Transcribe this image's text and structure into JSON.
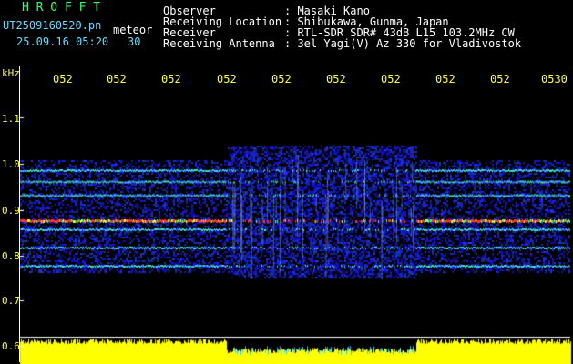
{
  "header": {
    "brand": "H R O F F T",
    "filename": "UT2509160520.pn",
    "mode": "meteor",
    "date_time": "25.09.16 05:20",
    "duration": "30",
    "info_labels": [
      "Observer",
      "Receiving Location",
      "Receiver",
      "Receiving Antenna"
    ],
    "info_values": [
      ": Masaki Kano",
      ": Shibukawa, Gunma, Japan",
      ": RTL-SDR SDR# 43dB L15 103.2MHz CW",
      ": 3el Yagi(V) Az 330 for Vladivostok"
    ]
  },
  "axes": {
    "y_unit": "kHz",
    "y_ticks": [
      "1.1",
      "1.0",
      "0.9",
      "0.8",
      "0.7",
      "0.6"
    ],
    "x_ticks": [
      "052",
      "052",
      "052",
      "052",
      "052",
      "052",
      "052",
      "052",
      "052",
      "0530"
    ]
  },
  "colors": {
    "accent_green": "#33ff66",
    "label_yellow": "#ffff33",
    "text_white": "#ffffff",
    "text_cyan": "#66ddff",
    "band_red": "#ff3030",
    "noise_blue": "#2030c0",
    "level_yellow": "#ffff00"
  },
  "chart_data": {
    "type": "heatmap",
    "ylabel": "kHz",
    "ylim": [
      0.6,
      1.15
    ],
    "signal_lines_khz": [
      0.99,
      0.965,
      0.935,
      0.88,
      0.86,
      0.82,
      0.78
    ],
    "strongest_line_khz": 0.88,
    "meteor_activity_window_fraction": [
      0.375,
      0.72
    ]
  }
}
